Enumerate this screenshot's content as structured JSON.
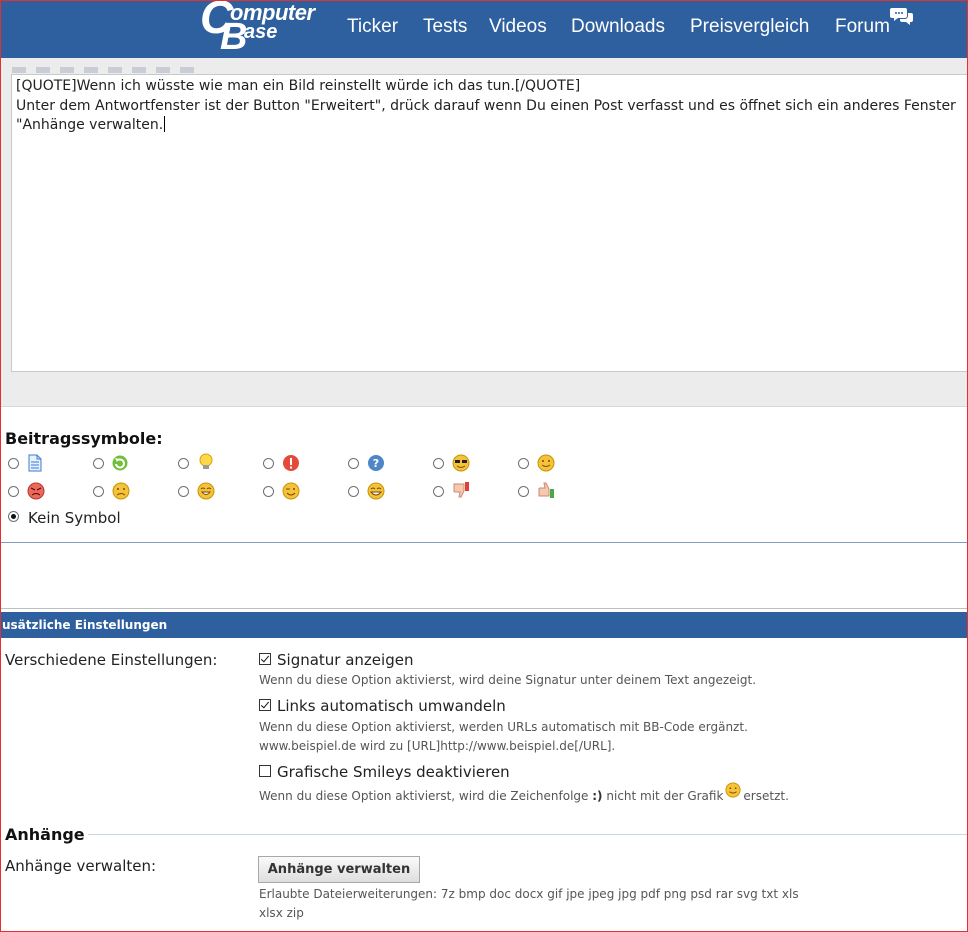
{
  "header": {
    "logo_line1": "omputer",
    "logo_line2": "ase",
    "logo_c": "C",
    "logo_b": "B",
    "brand_color": "#2e5f9e",
    "nav": [
      {
        "label": "Ticker"
      },
      {
        "label": "Tests"
      },
      {
        "label": "Videos"
      },
      {
        "label": "Downloads"
      },
      {
        "label": "Preisvergleich"
      },
      {
        "label": "Forum"
      }
    ],
    "forum_icon": "chat-bubbles-icon"
  },
  "editor": {
    "lines": [
      "[QUOTE]Wenn ich wüsste wie man ein Bild reinstellt würde ich das tun.[/QUOTE]",
      "Unter dem Antwortfenster ist der Button \"Erweitert\", drück darauf wenn Du einen Post verfasst und es öffnet sich ein anderes Fenster",
      "\"Anhänge verwalten."
    ]
  },
  "post_icons": {
    "title": "Beitragssymbole:",
    "icons": [
      "document-icon",
      "refresh-arrow-icon",
      "lightbulb-icon",
      "exclamation-icon",
      "question-icon",
      "sunglasses-smiley-icon",
      "smile-smiley-icon",
      "angry-smiley-icon",
      "frown-smiley-icon",
      "grin-smiley-icon",
      "wink-smiley-icon",
      "laugh-smiley-icon",
      "thumbs-down-icon",
      "thumbs-up-icon"
    ],
    "no_icon_label": "Kein Symbol",
    "selected": "no_icon"
  },
  "settings": {
    "section_title": "usätzliche Einstellungen",
    "misc_label": "Verschiedene Einstellungen:",
    "options": [
      {
        "label": "Signatur anzeigen",
        "checked": true,
        "desc": [
          "Wenn du diese Option aktivierst, wird deine Signatur unter deinem Text angezeigt."
        ]
      },
      {
        "label": "Links automatisch umwandeln",
        "checked": true,
        "desc": [
          "Wenn du diese Option aktivierst, werden URLs automatisch mit BB-Code ergänzt.",
          "www.beispiel.de wird zu [URL]http://www.beispiel.de[/URL]."
        ]
      },
      {
        "label": "Grafische Smileys deaktivieren",
        "checked": false,
        "desc_before": "Wenn du diese Option aktivierst, wird die Zeichenfolge",
        "desc_code": ":)",
        "desc_mid": "nicht mit der Grafik",
        "desc_after": "ersetzt."
      }
    ]
  },
  "attachments": {
    "title": "Anhänge",
    "manage_label": "Anhänge verwalten:",
    "button_label": "Anhänge verwalten",
    "allowed_line1": "Erlaubte Dateierweiterungen: 7z bmp doc docx gif jpe jpeg jpg pdf png psd rar svg txt xls",
    "allowed_line2": "xlsx zip"
  }
}
